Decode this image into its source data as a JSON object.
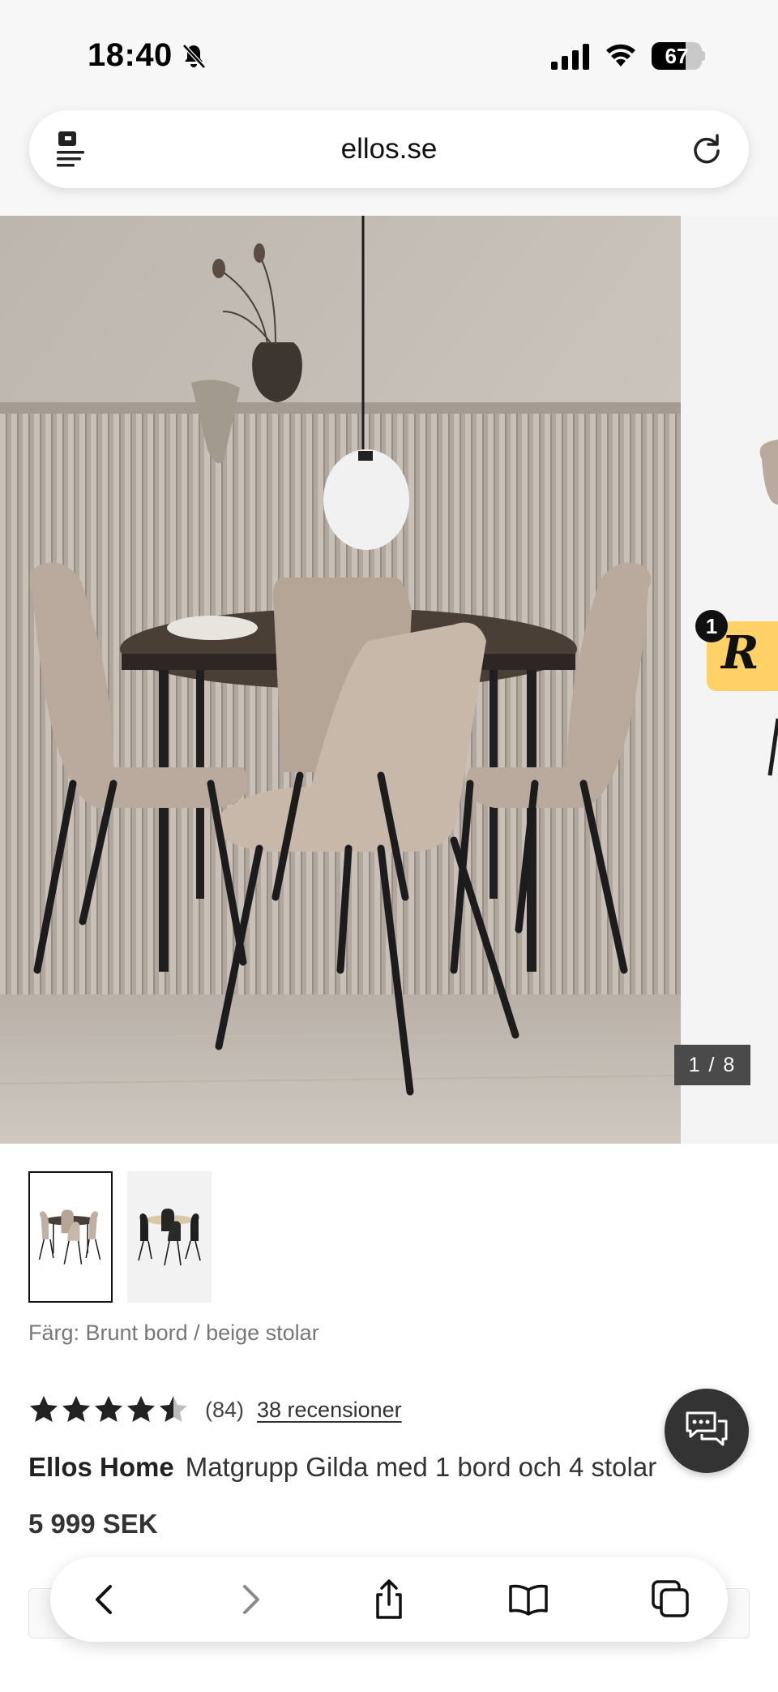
{
  "status_bar": {
    "time": "18:40",
    "battery_level": "67",
    "silent_mode_icon": "bell-slash-icon",
    "signal_icon": "cellular-signal-icon",
    "wifi_icon": "wifi-icon"
  },
  "browser": {
    "url": "ellos.se",
    "reader_icon": "reader-mode-icon",
    "reload_icon": "reload-icon"
  },
  "gallery": {
    "counter": "1 / 8",
    "badge_letter": "R",
    "badge_count": "1"
  },
  "thumbnails": [
    {
      "name": "thumbnail-brown-table-beige-chairs",
      "selected": true
    },
    {
      "name": "thumbnail-black-chairs",
      "selected": false
    }
  ],
  "product": {
    "color_label": "Färg: Brunt bord / beige stolar",
    "rating_value": 4.5,
    "rating_count": "(84)",
    "reviews_link": "38 recensioner",
    "brand": "Ellos Home",
    "title": "Matgrupp Gilda med 1 bord och 4 stolar",
    "price": "5 999 SEK"
  },
  "toolbar": {
    "items": [
      "back-icon",
      "forward-icon",
      "share-icon",
      "bookmarks-icon",
      "tabs-icon"
    ]
  },
  "colors": {
    "accent_dark": "#333333",
    "badge_yellow": "#ffd166",
    "link_gray": "#333333"
  }
}
